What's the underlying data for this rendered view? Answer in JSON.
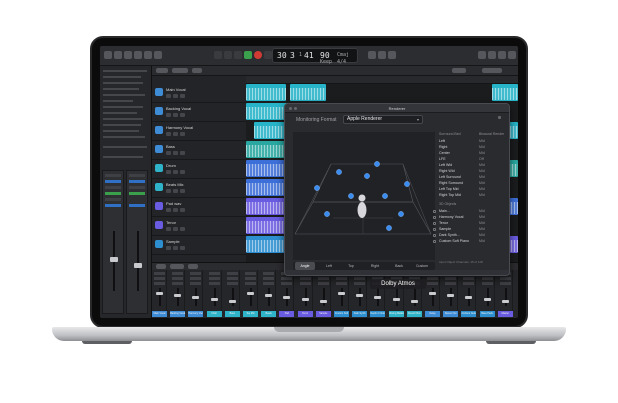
{
  "control_bar": {
    "lcd_bar": "30",
    "lcd_beat": "3",
    "lcd_sub": "1",
    "lcd_tick": "41",
    "lcd_tempo": "90",
    "lcd_tempo_label": "Keep",
    "lcd_key": "Cmaj",
    "lcd_sig": "4/4"
  },
  "tracks": [
    {
      "name": "Main Vocal",
      "color": "#3e8bd6"
    },
    {
      "name": "Backing Vocal",
      "color": "#3e8bd6"
    },
    {
      "name": "Harmony Vocal",
      "color": "#3e8bd6"
    },
    {
      "name": "Bass",
      "color": "#3e8bd6"
    },
    {
      "name": "Drum",
      "color": "#2fb3c9"
    },
    {
      "name": "Beats Mix",
      "color": "#2fb3c9"
    },
    {
      "name": "Pad wav",
      "color": "#6a5ce0"
    },
    {
      "name": "Tenor",
      "color": "#6a5ce0"
    },
    {
      "name": "Sample",
      "color": "#2d8fcf"
    }
  ],
  "renderer": {
    "title": "Renderer",
    "monitoring_label": "Monitoring Format",
    "monitoring_value": "Apple Renderer",
    "view_tabs": [
      "Angle",
      "Left",
      "Top",
      "Right",
      "Back",
      "Custom"
    ],
    "view_selected": 0,
    "speakers_header": "Surround Bed",
    "mode_header": "Binaural Render",
    "objects_header": "3D Objects",
    "beds": [
      {
        "name": "Left",
        "mode": "Mid"
      },
      {
        "name": "Right",
        "mode": "Mid"
      },
      {
        "name": "Center",
        "mode": "Mid"
      },
      {
        "name": "LFE",
        "mode": "Off"
      },
      {
        "name": "Left Wid",
        "mode": "Mid"
      },
      {
        "name": "Right Wid",
        "mode": "Mid"
      },
      {
        "name": "Left Surround",
        "mode": "Mid"
      },
      {
        "name": "Right Surround",
        "mode": "Mid"
      },
      {
        "name": "Left Top Mid",
        "mode": "Mid"
      },
      {
        "name": "Right Top Mid",
        "mode": "Mid"
      }
    ],
    "objects": [
      {
        "name": "Main...",
        "mode": "Mid"
      },
      {
        "name": "Harmony Vocal",
        "mode": "Mid"
      },
      {
        "name": "Tenor",
        "mode": "Mid"
      },
      {
        "name": "Sample",
        "mode": "Mid"
      },
      {
        "name": "Dark Synth...",
        "mode": "Mid"
      },
      {
        "name": "Custom Soft Piano",
        "mode": "Mid"
      }
    ],
    "footer_note": "Input Object Channels: 15 of 118"
  },
  "mixer_strips": [
    {
      "name": "Main Vocal",
      "color": "#3e8bd6"
    },
    {
      "name": "Backing Vocal",
      "color": "#3e8bd6"
    },
    {
      "name": "Harmony Vocal",
      "color": "#3e8bd6"
    },
    {
      "name": "Choir",
      "color": "#2fb3c9"
    },
    {
      "name": "Bass",
      "color": "#2fb3c9"
    },
    {
      "name": "Tee Mix",
      "color": "#2fb3c9"
    },
    {
      "name": "Beats",
      "color": "#2fb3c9"
    },
    {
      "name": "Pad",
      "color": "#6a5ce0"
    },
    {
      "name": "Tenor",
      "color": "#6a5ce0"
    },
    {
      "name": "Sample",
      "color": "#6a5ce0"
    },
    {
      "name": "Custom Soft",
      "color": "#2d8fcf"
    },
    {
      "name": "Dark Synth",
      "color": "#2d8fcf"
    },
    {
      "name": "Depth of Voices",
      "color": "#2d8fcf"
    },
    {
      "name": "Moving Mallets",
      "color": "#2fb3c9"
    },
    {
      "name": "Reverb Bus",
      "color": "#2fb3c9"
    },
    {
      "name": "Delay",
      "color": "#3e8bd6"
    },
    {
      "name": "Stereo Out",
      "color": "#3e8bd6"
    },
    {
      "name": "Ambient Guitar",
      "color": "#2d8fcf"
    },
    {
      "name": "Bass Pads",
      "color": "#2d8fcf"
    },
    {
      "name": "Master",
      "color": "#6a5ce0"
    }
  ],
  "overlay_label": "Dolby Atmos",
  "colors": {
    "accent_cyan": "#27b3c8",
    "accent_blue": "#3d6fd8",
    "accent_purple": "#6a5ce0",
    "play_green": "#3aa04b",
    "record_red": "#d23b34"
  }
}
